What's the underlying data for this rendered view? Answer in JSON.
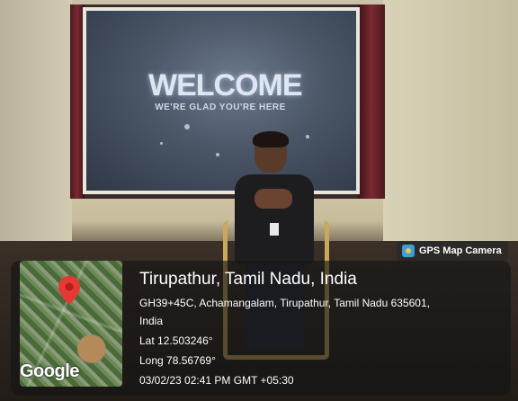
{
  "photo": {
    "screen_text": {
      "headline": "WELCOME",
      "subline": "WE'RE GLAD YOU'RE HERE"
    }
  },
  "overlay": {
    "app_tag": "GPS Map Camera",
    "title": "Tirupathur, Tamil Nadu, India",
    "address_line1": "GH39+45C, Achamangalam, Tirupathur, Tamil Nadu 635601,",
    "address_line2": "India",
    "latitude": "Lat 12.503246°",
    "longitude": "Long 78.56769°",
    "timestamp": "03/02/23 02:41 PM GMT +05:30",
    "map_logo": "Google",
    "icons": {
      "app": "gps-map-camera-icon",
      "pin": "map-pin-icon"
    },
    "colors": {
      "pin": "#e53935",
      "panel": "#141414"
    }
  }
}
